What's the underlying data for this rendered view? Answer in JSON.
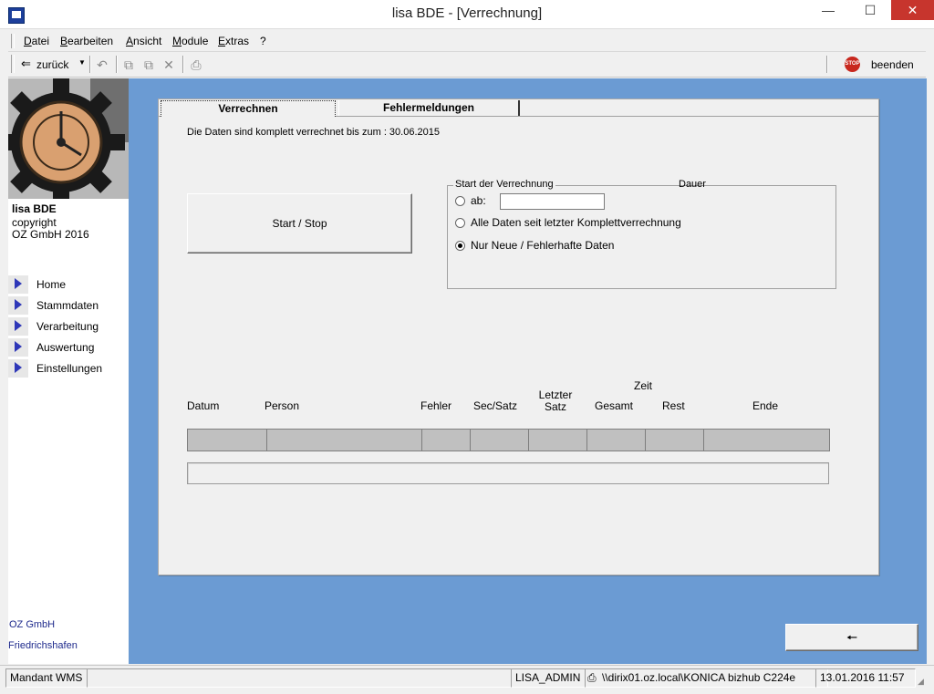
{
  "window": {
    "title": "lisa    BDE - [Verrechnung]",
    "minimize": "—",
    "maximize": "☐",
    "close": "✕"
  },
  "menu": [
    "Datei",
    "Bearbeiten",
    "Ansicht",
    "Module",
    "Extras",
    "?"
  ],
  "toolbar": {
    "back_label": "zurück",
    "quit_label": "beenden",
    "stop_icon_text": "STOP"
  },
  "sidebar": {
    "app_name": "lisa BDE",
    "copyright": "copyright",
    "company_year": "OZ GmbH 2016",
    "nav": [
      "Home",
      "Stammdaten",
      "Verarbeitung",
      "Auswertung",
      "Einstellungen"
    ],
    "footer_company": "OZ GmbH",
    "footer_city": "Friedrichshafen"
  },
  "tabs": [
    "Verrechnen",
    "Fehlermeldungen"
  ],
  "info": "Die Daten sind komplett verrechnet bis zum :  30.06.2015",
  "start_stop_label": "Start / Stop",
  "group": {
    "title": "Start der Verrechnung",
    "duration_label": "Dauer",
    "options": [
      {
        "label": "ab:",
        "selected": false
      },
      {
        "label": "Alle Daten seit letzter Komplettverrechnung",
        "selected": false
      },
      {
        "label": "Nur Neue / Fehlerhafte Daten",
        "selected": true
      }
    ],
    "from_value": ""
  },
  "table": {
    "zeit_label": "Zeit",
    "columns": [
      "Datum",
      "Person",
      "Fehler",
      "Sec/Satz",
      "Letzter Satz",
      "Gesamt",
      "Rest",
      "Ende"
    ]
  },
  "back_arrow": "🠔",
  "statusbar": {
    "mandant": "Mandant WMS",
    "user": "LISA_ADMIN",
    "printer": "\\\\dirix01.oz.local\\KONICA bizhub C224e",
    "datetime": "13.01.2016 11:57"
  },
  "colors": {
    "main_bg": "#6b9bd3",
    "nav_arrow": "#2e37b8",
    "close_btn": "#c7352d",
    "footer_text": "#1e2a8c"
  }
}
